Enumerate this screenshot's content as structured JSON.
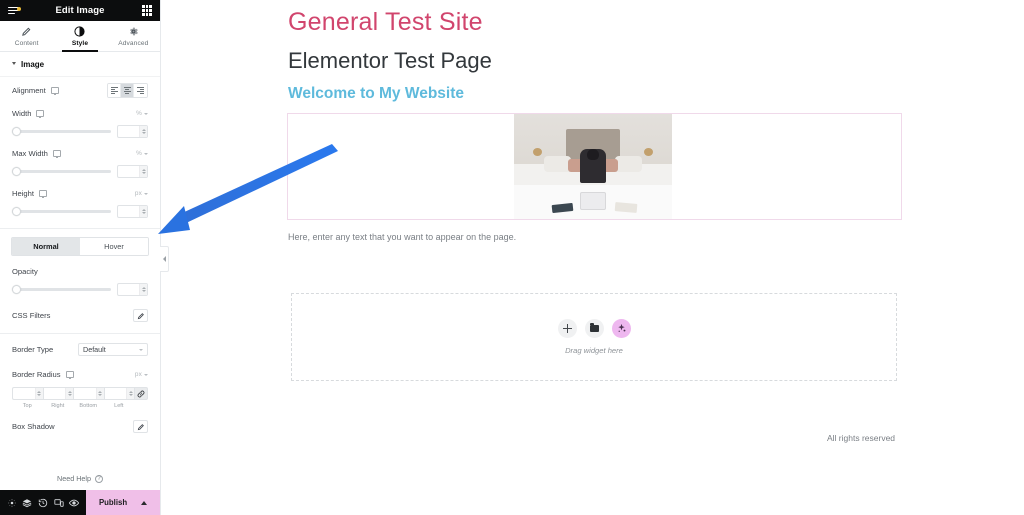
{
  "panel": {
    "header": {
      "title": "Edit Image",
      "menu_icon": "hamburger-menu-icon",
      "apps_icon": "grid-apps-icon"
    },
    "tabs": [
      {
        "label": "Content",
        "icon": "pencil-icon",
        "active": false
      },
      {
        "label": "Style",
        "icon": "contrast-circle-icon",
        "active": true
      },
      {
        "label": "Advanced",
        "icon": "gear-icon",
        "active": false
      }
    ],
    "section": {
      "title": "Image",
      "collapsed": false
    },
    "controls": {
      "alignment": {
        "label": "Alignment",
        "device": "desktop",
        "options": [
          "left",
          "center",
          "right"
        ],
        "selected": "center"
      },
      "width": {
        "label": "Width",
        "device": "desktop",
        "unit": "%",
        "value": "",
        "slider_pct": 0
      },
      "max_width": {
        "label": "Max Width",
        "device": "desktop",
        "unit": "%",
        "value": "",
        "slider_pct": 0
      },
      "height": {
        "label": "Height",
        "device": "desktop",
        "unit": "px",
        "value": "",
        "slider_pct": 0
      },
      "state_tabs": {
        "normal": "Normal",
        "hover": "Hover",
        "active": "Normal"
      },
      "opacity": {
        "label": "Opacity",
        "value": "",
        "slider_pct": 0
      },
      "css_filters": {
        "label": "CSS Filters",
        "edit_icon": "pencil-edit-icon"
      },
      "border_type": {
        "label": "Border Type",
        "value": "Default"
      },
      "border_radius": {
        "label": "Border Radius",
        "device": "desktop",
        "unit": "px",
        "sides": [
          {
            "cap": "Top",
            "value": ""
          },
          {
            "cap": "Right",
            "value": ""
          },
          {
            "cap": "Bottom",
            "value": ""
          },
          {
            "cap": "Left",
            "value": ""
          }
        ],
        "link_icon": "link-chain-icon"
      },
      "box_shadow": {
        "label": "Box Shadow",
        "edit_icon": "pencil-edit-icon"
      }
    },
    "need_help": {
      "label": "Need Help",
      "icon": "question-circle-icon"
    },
    "footer": {
      "tools": [
        {
          "name": "settings-icon"
        },
        {
          "name": "navigator-layers-icon"
        },
        {
          "name": "history-icon"
        },
        {
          "name": "responsive-mode-icon"
        },
        {
          "name": "preview-eye-icon"
        }
      ],
      "publish_label": "Publish",
      "publish_color": "#f0bfe8"
    },
    "collapse_handle": "chevron-left-icon"
  },
  "canvas": {
    "site_title": "General Test Site",
    "page_title": "Elementor Test Page",
    "welcome_heading": "Welcome to My Website",
    "body_text": "Here, enter any text that you want to appear on the page.",
    "image_widget": {
      "alt": "woman sitting on bed with laptop",
      "aligned": "center"
    },
    "dropzone": {
      "label": "Drag widget here",
      "buttons": [
        {
          "name": "add-widget-button",
          "icon": "plus-icon"
        },
        {
          "name": "add-template-button",
          "icon": "folder-icon"
        },
        {
          "name": "ai-builder-button",
          "icon": "sparkle-ai-icon"
        }
      ]
    },
    "footer_text": "All rights reserved"
  },
  "annotation": {
    "type": "arrow",
    "color": "#2a72e0",
    "points_to": "Normal / Hover state tabs"
  },
  "colors": {
    "site_title": "#d1456d",
    "page_title": "#33383c",
    "welcome": "#5ebadc",
    "section_border": "#f0d9ea",
    "panel_dark": "#0c0d0e"
  }
}
